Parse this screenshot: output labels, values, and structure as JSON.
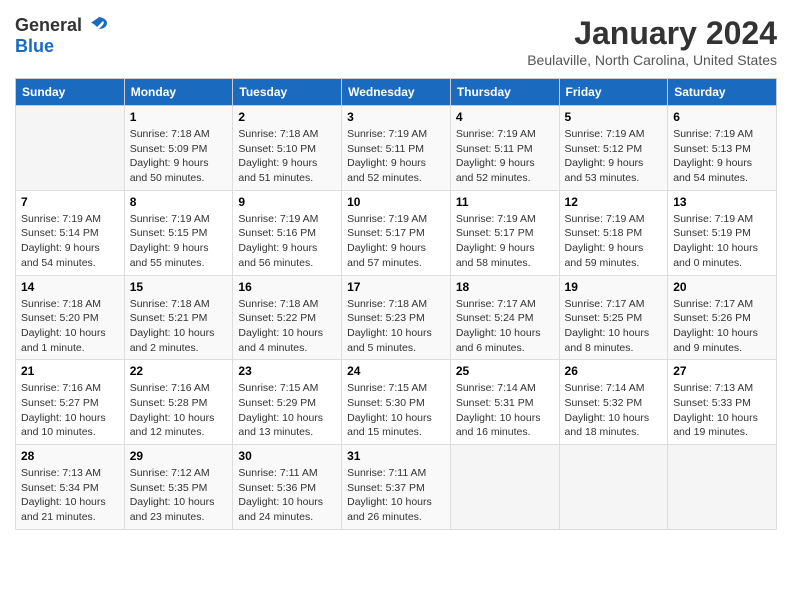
{
  "header": {
    "logo_line1": "General",
    "logo_line2": "Blue",
    "title": "January 2024",
    "subtitle": "Beulaville, North Carolina, United States"
  },
  "days_of_week": [
    "Sunday",
    "Monday",
    "Tuesday",
    "Wednesday",
    "Thursday",
    "Friday",
    "Saturday"
  ],
  "weeks": [
    [
      {
        "day": "",
        "info": ""
      },
      {
        "day": "1",
        "info": "Sunrise: 7:18 AM\nSunset: 5:09 PM\nDaylight: 9 hours\nand 50 minutes."
      },
      {
        "day": "2",
        "info": "Sunrise: 7:18 AM\nSunset: 5:10 PM\nDaylight: 9 hours\nand 51 minutes."
      },
      {
        "day": "3",
        "info": "Sunrise: 7:19 AM\nSunset: 5:11 PM\nDaylight: 9 hours\nand 52 minutes."
      },
      {
        "day": "4",
        "info": "Sunrise: 7:19 AM\nSunset: 5:11 PM\nDaylight: 9 hours\nand 52 minutes."
      },
      {
        "day": "5",
        "info": "Sunrise: 7:19 AM\nSunset: 5:12 PM\nDaylight: 9 hours\nand 53 minutes."
      },
      {
        "day": "6",
        "info": "Sunrise: 7:19 AM\nSunset: 5:13 PM\nDaylight: 9 hours\nand 54 minutes."
      }
    ],
    [
      {
        "day": "7",
        "info": "Sunrise: 7:19 AM\nSunset: 5:14 PM\nDaylight: 9 hours\nand 54 minutes."
      },
      {
        "day": "8",
        "info": "Sunrise: 7:19 AM\nSunset: 5:15 PM\nDaylight: 9 hours\nand 55 minutes."
      },
      {
        "day": "9",
        "info": "Sunrise: 7:19 AM\nSunset: 5:16 PM\nDaylight: 9 hours\nand 56 minutes."
      },
      {
        "day": "10",
        "info": "Sunrise: 7:19 AM\nSunset: 5:17 PM\nDaylight: 9 hours\nand 57 minutes."
      },
      {
        "day": "11",
        "info": "Sunrise: 7:19 AM\nSunset: 5:17 PM\nDaylight: 9 hours\nand 58 minutes."
      },
      {
        "day": "12",
        "info": "Sunrise: 7:19 AM\nSunset: 5:18 PM\nDaylight: 9 hours\nand 59 minutes."
      },
      {
        "day": "13",
        "info": "Sunrise: 7:19 AM\nSunset: 5:19 PM\nDaylight: 10 hours\nand 0 minutes."
      }
    ],
    [
      {
        "day": "14",
        "info": "Sunrise: 7:18 AM\nSunset: 5:20 PM\nDaylight: 10 hours\nand 1 minute."
      },
      {
        "day": "15",
        "info": "Sunrise: 7:18 AM\nSunset: 5:21 PM\nDaylight: 10 hours\nand 2 minutes."
      },
      {
        "day": "16",
        "info": "Sunrise: 7:18 AM\nSunset: 5:22 PM\nDaylight: 10 hours\nand 4 minutes."
      },
      {
        "day": "17",
        "info": "Sunrise: 7:18 AM\nSunset: 5:23 PM\nDaylight: 10 hours\nand 5 minutes."
      },
      {
        "day": "18",
        "info": "Sunrise: 7:17 AM\nSunset: 5:24 PM\nDaylight: 10 hours\nand 6 minutes."
      },
      {
        "day": "19",
        "info": "Sunrise: 7:17 AM\nSunset: 5:25 PM\nDaylight: 10 hours\nand 8 minutes."
      },
      {
        "day": "20",
        "info": "Sunrise: 7:17 AM\nSunset: 5:26 PM\nDaylight: 10 hours\nand 9 minutes."
      }
    ],
    [
      {
        "day": "21",
        "info": "Sunrise: 7:16 AM\nSunset: 5:27 PM\nDaylight: 10 hours\nand 10 minutes."
      },
      {
        "day": "22",
        "info": "Sunrise: 7:16 AM\nSunset: 5:28 PM\nDaylight: 10 hours\nand 12 minutes."
      },
      {
        "day": "23",
        "info": "Sunrise: 7:15 AM\nSunset: 5:29 PM\nDaylight: 10 hours\nand 13 minutes."
      },
      {
        "day": "24",
        "info": "Sunrise: 7:15 AM\nSunset: 5:30 PM\nDaylight: 10 hours\nand 15 minutes."
      },
      {
        "day": "25",
        "info": "Sunrise: 7:14 AM\nSunset: 5:31 PM\nDaylight: 10 hours\nand 16 minutes."
      },
      {
        "day": "26",
        "info": "Sunrise: 7:14 AM\nSunset: 5:32 PM\nDaylight: 10 hours\nand 18 minutes."
      },
      {
        "day": "27",
        "info": "Sunrise: 7:13 AM\nSunset: 5:33 PM\nDaylight: 10 hours\nand 19 minutes."
      }
    ],
    [
      {
        "day": "28",
        "info": "Sunrise: 7:13 AM\nSunset: 5:34 PM\nDaylight: 10 hours\nand 21 minutes."
      },
      {
        "day": "29",
        "info": "Sunrise: 7:12 AM\nSunset: 5:35 PM\nDaylight: 10 hours\nand 23 minutes."
      },
      {
        "day": "30",
        "info": "Sunrise: 7:11 AM\nSunset: 5:36 PM\nDaylight: 10 hours\nand 24 minutes."
      },
      {
        "day": "31",
        "info": "Sunrise: 7:11 AM\nSunset: 5:37 PM\nDaylight: 10 hours\nand 26 minutes."
      },
      {
        "day": "",
        "info": ""
      },
      {
        "day": "",
        "info": ""
      },
      {
        "day": "",
        "info": ""
      }
    ]
  ]
}
